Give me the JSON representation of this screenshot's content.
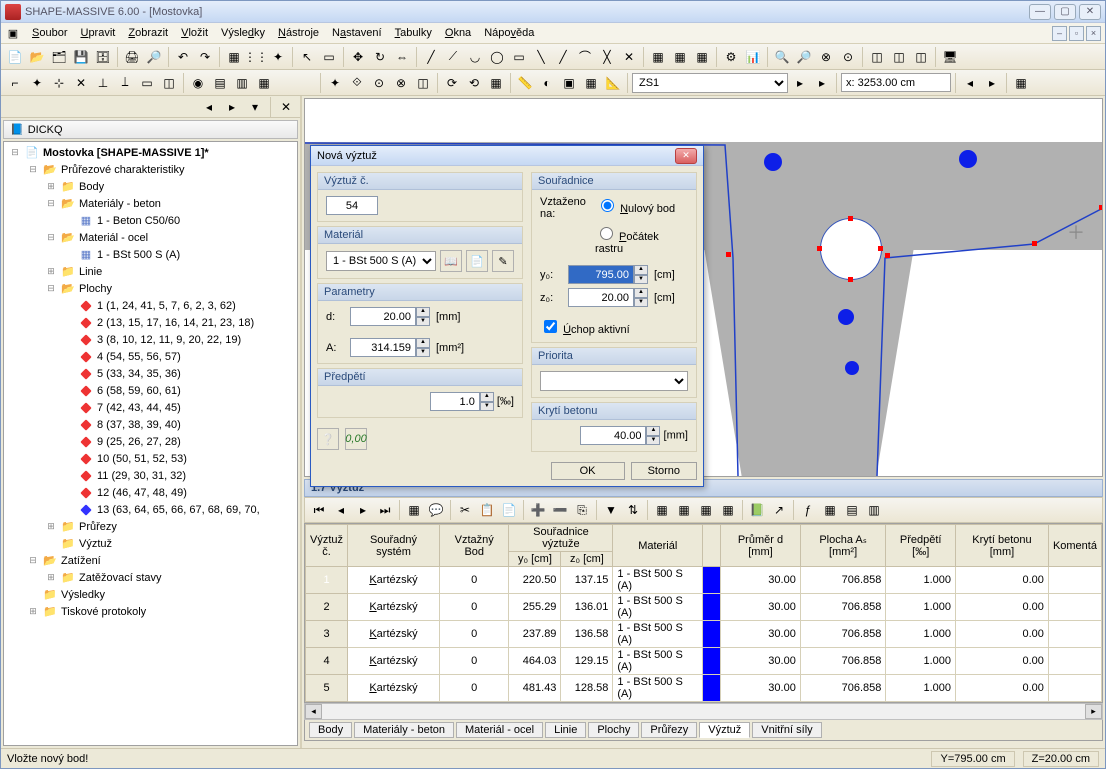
{
  "window": {
    "title": "SHAPE-MASSIVE 6.00 - [Mostovka]"
  },
  "menu": [
    "Soubor",
    "Upravit",
    "Zobrazit",
    "Vložit",
    "Výsledky",
    "Nástroje",
    "Nastavení",
    "Tabulky",
    "Okna",
    "Nápověda"
  ],
  "toolbar2": {
    "combo": "ZS1",
    "coord": "x: 3253.00 cm"
  },
  "nav": {
    "title": "DICKQ",
    "root": "Mostovka [SHAPE-MASSIVE 1]*",
    "sec": "Průřezové charakteristiky",
    "body": "Body",
    "matbeton": "Materiály - beton",
    "beton1": "1 - Beton C50/60",
    "matocel": "Materiál - ocel",
    "ocel1": "1 - BSt 500 S (A)",
    "linie": "Linie",
    "plochy": "Plochy",
    "p": [
      "1 (1, 24, 41, 5, 7, 6, 2, 3, 62)",
      "2 (13, 15, 17, 16, 14, 21, 23, 18)",
      "3 (8, 10, 12, 11, 9, 20, 22, 19)",
      "4 (54, 55, 56, 57)",
      "5 (33, 34, 35, 36)",
      "6 (58, 59, 60, 61)",
      "7 (42, 43, 44, 45)",
      "8 (37, 38, 39, 40)",
      "9 (25, 26, 27, 28)",
      "10 (50, 51, 52, 53)",
      "11 (29, 30, 31, 32)",
      "12 (46, 47, 48, 49)",
      "13 (63, 64, 65, 66, 67, 68, 69, 70,"
    ],
    "prurezy": "Průřezy",
    "vyztuz": "Výztuž",
    "zatizeni": "Zatížení",
    "zatstavy": "Zatěžovací stavy",
    "vysledky": "Výsledky",
    "tisk": "Tiskové protokoly"
  },
  "table": {
    "title": "1.7 Výztuž",
    "headers": {
      "num": "Výztuž č.",
      "sys": "Souřadný systém",
      "bod": "Vztažný Bod",
      "coords": "Souřadnice výztuže",
      "y0": "y₀ [cm]",
      "z0": "z₀ [cm]",
      "mat": "Materiál",
      "prumer": "Průměr d [mm]",
      "plocha": "Plocha Aₛ [mm²]",
      "pred": "Předpětí [‰]",
      "kryti": "Krytí betonu [mm]",
      "koment": "Komentá"
    },
    "rows": [
      {
        "n": "1",
        "sys": "Kartézský",
        "bod": "0",
        "y0": "220.50",
        "z0": "137.15",
        "mat": "1 - BSt 500 S (A)",
        "d": "30.00",
        "a": "706.858",
        "p": "1.000",
        "k": "0.00"
      },
      {
        "n": "2",
        "sys": "Kartézský",
        "bod": "0",
        "y0": "255.29",
        "z0": "136.01",
        "mat": "1 - BSt 500 S (A)",
        "d": "30.00",
        "a": "706.858",
        "p": "1.000",
        "k": "0.00"
      },
      {
        "n": "3",
        "sys": "Kartézský",
        "bod": "0",
        "y0": "237.89",
        "z0": "136.58",
        "mat": "1 - BSt 500 S (A)",
        "d": "30.00",
        "a": "706.858",
        "p": "1.000",
        "k": "0.00"
      },
      {
        "n": "4",
        "sys": "Kartézský",
        "bod": "0",
        "y0": "464.03",
        "z0": "129.15",
        "mat": "1 - BSt 500 S (A)",
        "d": "30.00",
        "a": "706.858",
        "p": "1.000",
        "k": "0.00"
      },
      {
        "n": "5",
        "sys": "Kartézský",
        "bod": "0",
        "y0": "481.43",
        "z0": "128.58",
        "mat": "1 - BSt 500 S (A)",
        "d": "30.00",
        "a": "706.858",
        "p": "1.000",
        "k": "0.00"
      }
    ],
    "tabs": [
      "Body",
      "Materiály - beton",
      "Materiál - ocel",
      "Linie",
      "Plochy",
      "Průřezy",
      "Výztuž",
      "Vnitřní síly"
    ]
  },
  "dialog": {
    "title": "Nová výztuž",
    "vyztuzc": "Výztuž č.",
    "num": "54",
    "material": "Materiál",
    "matval": "1 - BSt 500 S (A)",
    "param": "Parametry",
    "d": "d:",
    "dval": "20.00",
    "dunit": "[mm]",
    "a": "A:",
    "aval": "314.159",
    "aunit": "[mm²]",
    "predpeti": "Předpětí",
    "predval": "1.0",
    "predunit": "[‰]",
    "sour": "Souřadnice",
    "vzt": "Vztaženo na:",
    "r1": "Nulový bod",
    "r2": "Počátek rastru",
    "y0": "y₀:",
    "y0val": "795.00",
    "y0unit": "[cm]",
    "z0": "z₀:",
    "z0val": "20.00",
    "z0unit": "[cm]",
    "uchop": "Úchop aktivní",
    "priorita": "Priorita",
    "kryti": "Krytí betonu",
    "krytival": "40.00",
    "krytiunit": "[mm]",
    "ok": "OK",
    "storno": "Storno"
  },
  "status": {
    "msg": "Vložte nový bod!",
    "y": "Y=795.00  cm",
    "z": "Z=20.00  cm"
  }
}
